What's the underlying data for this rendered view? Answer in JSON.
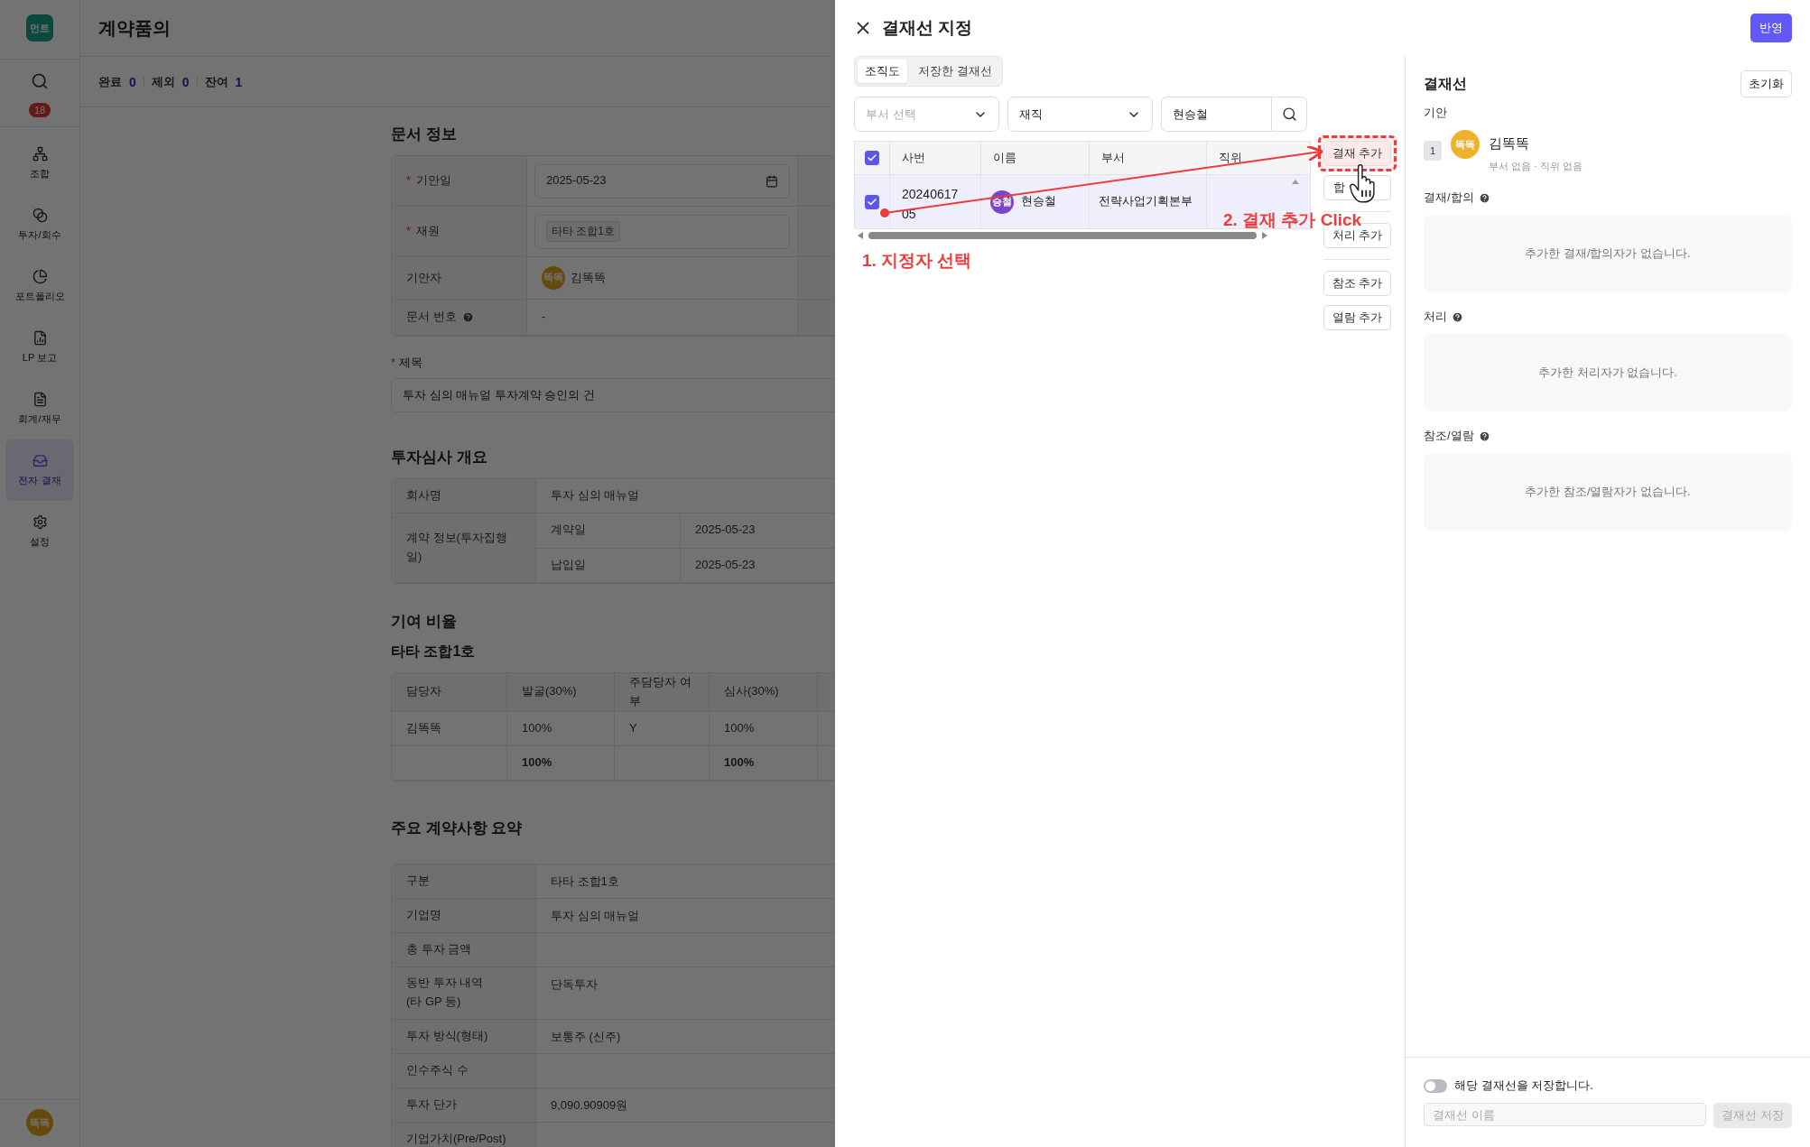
{
  "sidebar": {
    "logo": "먼트",
    "notification_count": "18",
    "items": [
      {
        "label": "조합",
        "selected": false
      },
      {
        "label": "투자/회수",
        "selected": false
      },
      {
        "label": "포트폴리오",
        "selected": false
      },
      {
        "label": "LP 보고",
        "selected": false
      },
      {
        "label": "회계/재무",
        "selected": false
      },
      {
        "label": "전자 결재",
        "selected": true
      },
      {
        "label": "설정",
        "selected": false
      }
    ],
    "user_avatar": "똑똑"
  },
  "header": {
    "title": "계약품의"
  },
  "summary": [
    {
      "label": "완료",
      "count": "0"
    },
    {
      "label": "제외",
      "count": "0"
    },
    {
      "label": "잔여",
      "count": "1"
    }
  ],
  "document_info": {
    "title": "문서 정보",
    "rows": [
      {
        "label": "기안일",
        "required_mark": "*",
        "kind": "date",
        "value": "2025-05-23"
      },
      {
        "label": "재원",
        "required_mark": "*",
        "kind": "tag",
        "value": "타타 조합1호"
      },
      {
        "label": "기안자",
        "kind": "person",
        "avatar": "똑똑",
        "value": "김똑똑"
      },
      {
        "label": "문서 번호",
        "help": true,
        "kind": "text",
        "value": "-"
      }
    ],
    "subject_required_mark": "*",
    "subject_label": "제목",
    "subject_value": "투자 심의 매뉴얼 투자계약 승인의 건"
  },
  "review_overview": {
    "title": "투자심사 개요",
    "company_label": "회사명",
    "company_value": "투자 심의 매뉴얼",
    "contract_label": "계약 정보(투자집행일)",
    "contract_rows": [
      {
        "label": "계약일",
        "value": "2025-05-23"
      },
      {
        "label": "납입일",
        "value": "2025-05-23"
      }
    ]
  },
  "contribution": {
    "title": "기여 비율",
    "fund": "타타 조합1호",
    "columns": [
      "담당자",
      "발굴(30%)",
      "주담당자 여부",
      "심사(30%)"
    ],
    "rows": [
      {
        "kind": "data",
        "cells": [
          "김똑똑",
          "100%",
          "Y",
          "100%"
        ]
      },
      {
        "kind": "total",
        "cells": [
          null,
          "100%",
          null,
          "100%"
        ]
      }
    ]
  },
  "contract_summary": {
    "title": "주요 계약사항 요약",
    "rows": [
      {
        "label": "구분",
        "value": "타타 조합1호"
      },
      {
        "label": "기업명",
        "value": "투자 심의 매뉴얼"
      },
      {
        "label": "총 투자 금액"
      },
      {
        "label": "동반 투자 내역\n(타 GP 등)",
        "value": "단독투자"
      },
      {
        "label": "투자 방식(형태)",
        "value": "보통주 (신주)"
      },
      {
        "label": "인수주식 수"
      },
      {
        "label": "투자 단가",
        "value": "9,090.90909원"
      },
      {
        "label": "기업가치(Pre/Post)"
      }
    ]
  },
  "drawer": {
    "title": "결재선 지정",
    "apply_button": "반영",
    "tabs": [
      {
        "label": "조직도",
        "selected": true
      },
      {
        "label": "저장한 결재선",
        "selected": false
      }
    ],
    "department_select": {
      "placeholder": "부서 선택"
    },
    "status_select": {
      "value": "재직"
    },
    "search": {
      "value": "현승철"
    },
    "table": {
      "columns": [
        "사번",
        "이름",
        "부서",
        "직위"
      ],
      "all_checked": true,
      "rows": [
        {
          "employee_no": "2024061705",
          "avatar": "승철",
          "name": "현승철",
          "department": "전략사업기획본부",
          "checked": true,
          "selected": true
        }
      ]
    },
    "button_groups": [
      [
        {
          "label": "결재 추가",
          "highlighted": true
        },
        {
          "label": "합",
          "highlighted": false
        }
      ],
      [
        {
          "label": "처리 추가",
          "highlighted": false
        }
      ],
      [
        {
          "label": "참조 추가",
          "highlighted": false
        },
        {
          "label": "열람 추가",
          "highlighted": false
        }
      ]
    ],
    "annotations": [
      {
        "kind": "step",
        "text": "1. 지정자 선택"
      },
      {
        "kind": "step",
        "text": "2. 결재 추가 Click"
      }
    ]
  },
  "approval_line": {
    "title": "결재선",
    "reset_button": "초기화",
    "drafter_label": "기안",
    "drafter": {
      "order": "1",
      "avatar": "똑똑",
      "name": "김똑똑",
      "meta": "부서 없음 · 직위 없음"
    },
    "sections": [
      {
        "label": "결재/합의",
        "empty_text": "추가한 결재/합의자가 없습니다."
      },
      {
        "label": "처리",
        "empty_text": "추가한 처리자가 없습니다."
      },
      {
        "label": "참조/열람",
        "empty_text": "추가한 참조/열람자가 없습니다."
      }
    ]
  },
  "footer": {
    "save_toggle": {
      "label": "해당 결재선을 저장합니다.",
      "on": false
    },
    "name_field": {
      "placeholder": "결재선 이름"
    },
    "save_button": {
      "label": "결재선 저장",
      "disabled": true
    }
  }
}
